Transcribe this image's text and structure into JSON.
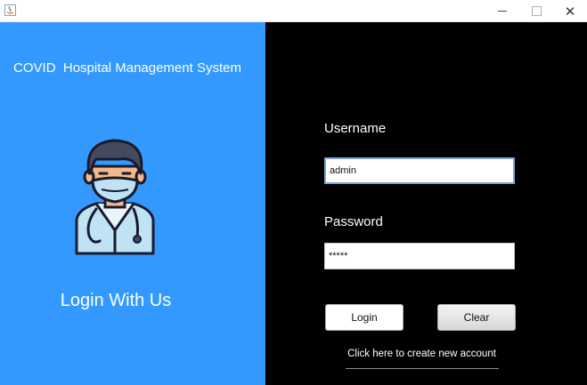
{
  "window": {
    "controls": {
      "minimize": "minimize",
      "maximize": "maximize",
      "close": "✕"
    }
  },
  "left": {
    "title": "COVID  Hospital Management System",
    "tagline": "Login With Us"
  },
  "form": {
    "username_label": "Username",
    "username_value": "admin",
    "password_label": "Password",
    "password_value": "*****",
    "login_label": "Login",
    "clear_label": "Clear",
    "create_account_link": "Click here to create new account"
  },
  "colors": {
    "left_panel": "#3399ff",
    "right_panel": "#000000",
    "text_light": "#ffffff"
  },
  "icons": {
    "app": "java-app-icon",
    "illustration": "doctor-with-mask-icon"
  }
}
